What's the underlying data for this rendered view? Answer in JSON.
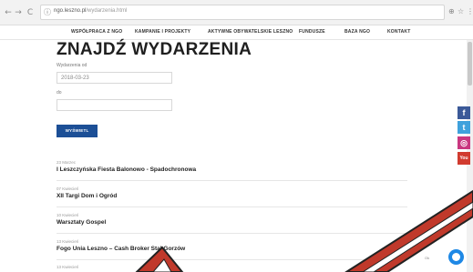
{
  "browser": {
    "url_host": "ngo.leszno.pl",
    "url_path": "/wydarzenia.html",
    "back_glyph": "←",
    "forward_glyph": "→",
    "reload_glyph": "C",
    "info_glyph": "ⓘ",
    "zoom_glyph": "⊕",
    "star_glyph": "☆",
    "menu_glyph": "⋮"
  },
  "menu": {
    "items": [
      {
        "label": "WSPÓŁPRACA Z NGO"
      },
      {
        "label": "KAMPANIE I PROJEKTY"
      },
      {
        "label": "AKTYWNE OBYWATELSKIE LESZNO"
      },
      {
        "label": "FUNDUSZE"
      },
      {
        "label": "BAZA NGO"
      },
      {
        "label": "KONTAKT"
      }
    ]
  },
  "main": {
    "title": "ZNAJDŹ WYDARZENIA",
    "from_label": "Wydarzenia od",
    "from_value": "2018-03-23",
    "to_label": "do",
    "to_value": "",
    "submit_label": "WYŚWIETL",
    "events": [
      {
        "date": "23 Marzec",
        "title": "I Leszczyńska Fiesta Balonowo - Spadochronowa"
      },
      {
        "date": "07 Kwiecień",
        "title": "XII Targi Dom i Ogród"
      },
      {
        "date": "10 Kwiecień",
        "title": "Warsztaty Gospel"
      },
      {
        "date": "13 Kwiecień",
        "title": "Fogo Unia Leszno – Cash Broker Stal Gorzów"
      },
      {
        "date": "13 Kwiecień",
        "title": ""
      }
    ]
  },
  "social": {
    "facebook": "f",
    "twitter": "t",
    "instagram": "◎",
    "youtube": "You"
  },
  "footer": {
    "cookie_text": "Ok"
  },
  "colors": {
    "button": "#1c4f96",
    "overlay_red": "#c0392b"
  }
}
